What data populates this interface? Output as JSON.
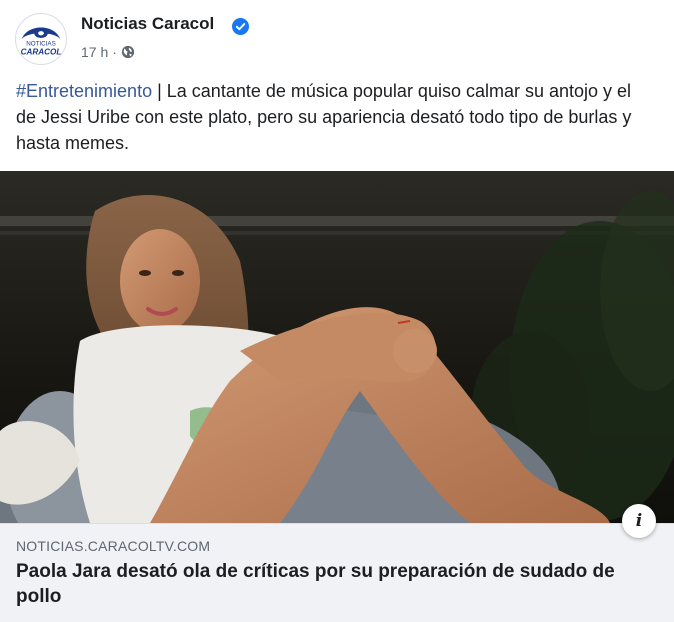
{
  "page": {
    "name": "Noticias Caracol",
    "time": "17 h",
    "separator": "·",
    "avatar_icon": "caracol-logo-icon",
    "verified_icon": "verified-badge-icon",
    "audience_icon": "globe-icon",
    "logo_text_top": "NOTICIAS",
    "logo_text_bottom": "CARACOL"
  },
  "post": {
    "hashtag": "#Entretenimiento",
    "text": " | La cantante de música popular quiso calmar su antojo y el de Jessi Uribe con este plato, pero su apariencia desató todo tipo de burlas y hasta memes."
  },
  "link_preview": {
    "domain": "NOTICIAS.CARACOLTV.COM",
    "headline": "Paola Jara desató ola de críticas por su preparación de sudado de pollo",
    "info_label": "i"
  },
  "colors": {
    "brand_blue": "#385898",
    "verified_blue": "#1877f2",
    "text": "#1c1e21",
    "muted": "#606770",
    "link_bg": "#f0f2f5"
  }
}
